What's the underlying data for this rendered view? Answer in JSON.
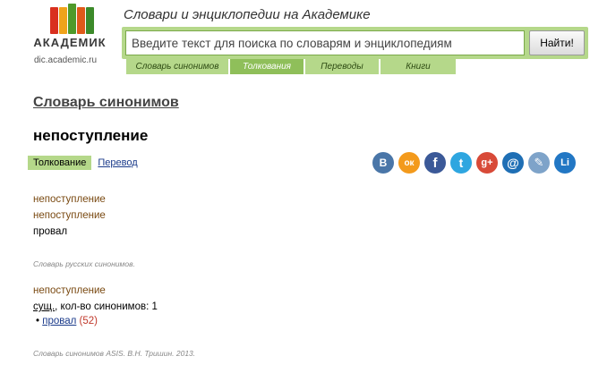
{
  "header": {
    "logo_text": "АКАДЕМИК",
    "logo_url": "dic.academic.ru",
    "site_title": "Словари и энциклопедии на Академике",
    "search_placeholder": "Введите текст для поиска по словарям и энциклопедиям",
    "search_button": "Найти!",
    "book_colors": [
      "#d9301f",
      "#f0a31a",
      "#4f9a2a",
      "#e05a1a",
      "#3c8a2a"
    ]
  },
  "nav": {
    "tabs": [
      {
        "label": "Словарь синонимов",
        "active": false
      },
      {
        "label": "Толкования",
        "active": true
      },
      {
        "label": "Переводы",
        "active": false
      },
      {
        "label": "Книги",
        "active": false
      }
    ]
  },
  "main": {
    "dict_title": "Словарь синонимов",
    "word": "непоступление",
    "subtab_active": "Толкование",
    "subtab_link": "Перевод"
  },
  "social": [
    {
      "name": "vk-icon",
      "glyph": "В",
      "color": "#4a76a8"
    },
    {
      "name": "odnoklassniki-icon",
      "glyph": "ок",
      "color": "#f39a1c"
    },
    {
      "name": "facebook-icon",
      "glyph": "f",
      "color": "#3b5998"
    },
    {
      "name": "twitter-icon",
      "glyph": "t",
      "color": "#2ea6e0"
    },
    {
      "name": "googleplus-icon",
      "glyph": "g+",
      "color": "#d84a38"
    },
    {
      "name": "mail-icon",
      "glyph": "@",
      "color": "#1f6fb5"
    },
    {
      "name": "livejournal-icon",
      "glyph": "✎",
      "color": "#7ea3c9"
    },
    {
      "name": "liveinternet-icon",
      "glyph": "Li",
      "color": "#2277c4"
    }
  ],
  "entry1": {
    "line1": "непоступление",
    "line2": "непоступление",
    "line3": "провал",
    "source": "Словарь русских синонимов."
  },
  "entry2": {
    "word": "непоступление",
    "pos": "сущ.",
    "count_text": ", кол-во синонимов: 1",
    "bullet": "•",
    "synonym": "провал",
    "synonym_count": "(52)",
    "source": "Словарь синонимов ASIS. В.Н. Тришин. 2013."
  }
}
